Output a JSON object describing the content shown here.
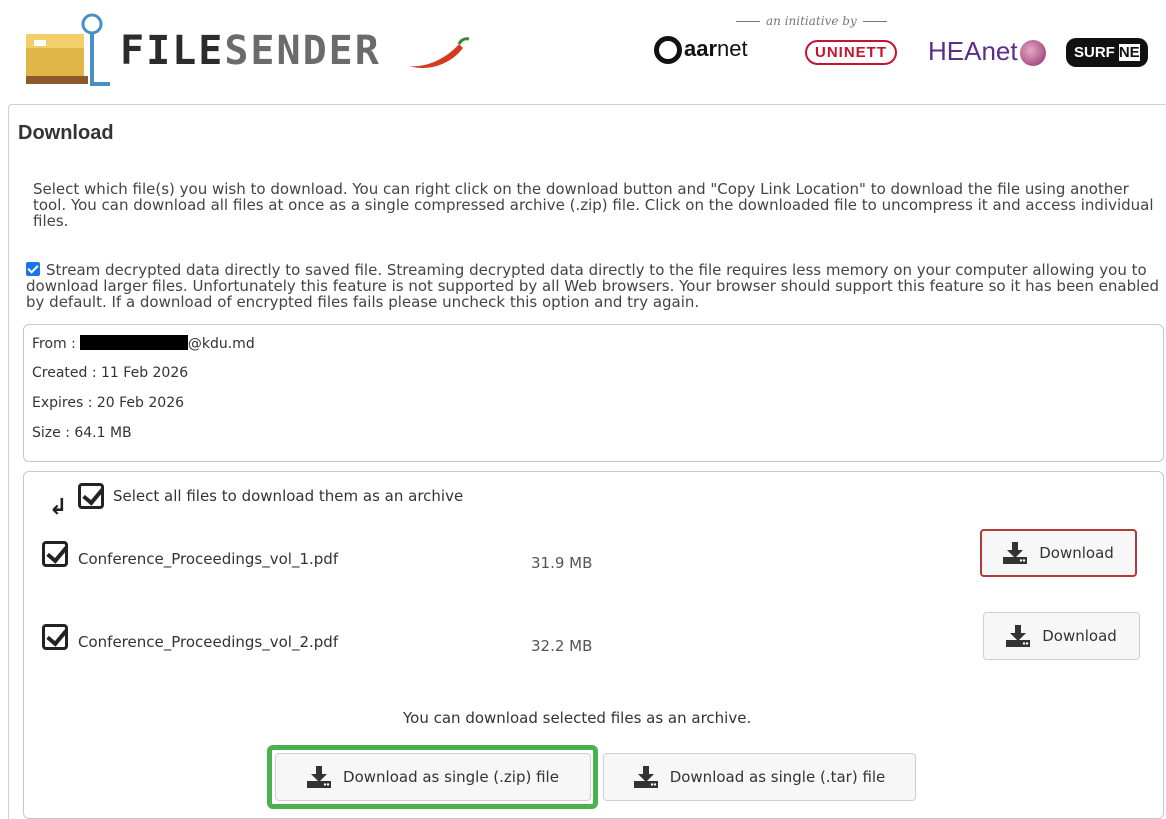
{
  "header": {
    "brand_bold": "FILE",
    "brand_light": "SENDER",
    "initiative": "an initiative by",
    "partners": {
      "aarnet_bold": "aar",
      "aarnet_rest": "net",
      "uninett": "UNINETT",
      "heanet": "HEAnet",
      "surf": "SURF",
      "surf_ne": "NE"
    }
  },
  "page": {
    "title": "Download",
    "intro": "Select which file(s) you wish to download. You can right click on the download button and \"Copy Link Location\" to download the file using another tool. You can download all files at once as a single compressed archive (.zip) file. Click on the downloaded file to uncompress it and access individual files.",
    "stream_text": "Stream decrypted data directly to saved file. Streaming decrypted data directly to the file requires less memory on your computer allowing you to download larger files. Unfortunately this feature is not supported by all Web browsers. Your browser should support this feature so it has been enabled by default. If a download of encrypted files fails please uncheck this option and try again."
  },
  "info": {
    "from_label": "From :",
    "from_domain": "@kdu.md",
    "created": "Created : 11 Feb 2026",
    "expires": "Expires : 20 Feb 2026",
    "size": "Size : 64.1 MB"
  },
  "files": {
    "select_all": "Select all files to download them as an archive",
    "items": [
      {
        "name": "Conference_Proceedings_vol_1.pdf",
        "size": "31.9 MB",
        "button": "Download"
      },
      {
        "name": "Conference_Proceedings_vol_2.pdf",
        "size": "32.2 MB",
        "button": "Download"
      }
    ],
    "archive_note": "You can download selected files as an archive.",
    "zip_button": "Download as single (.zip) file",
    "tar_button": "Download as single (.tar) file"
  },
  "colors": {
    "focus_border": "#b33a3a",
    "highlight_green": "#4caf50",
    "checkbox_blue": "#1a73e8"
  }
}
